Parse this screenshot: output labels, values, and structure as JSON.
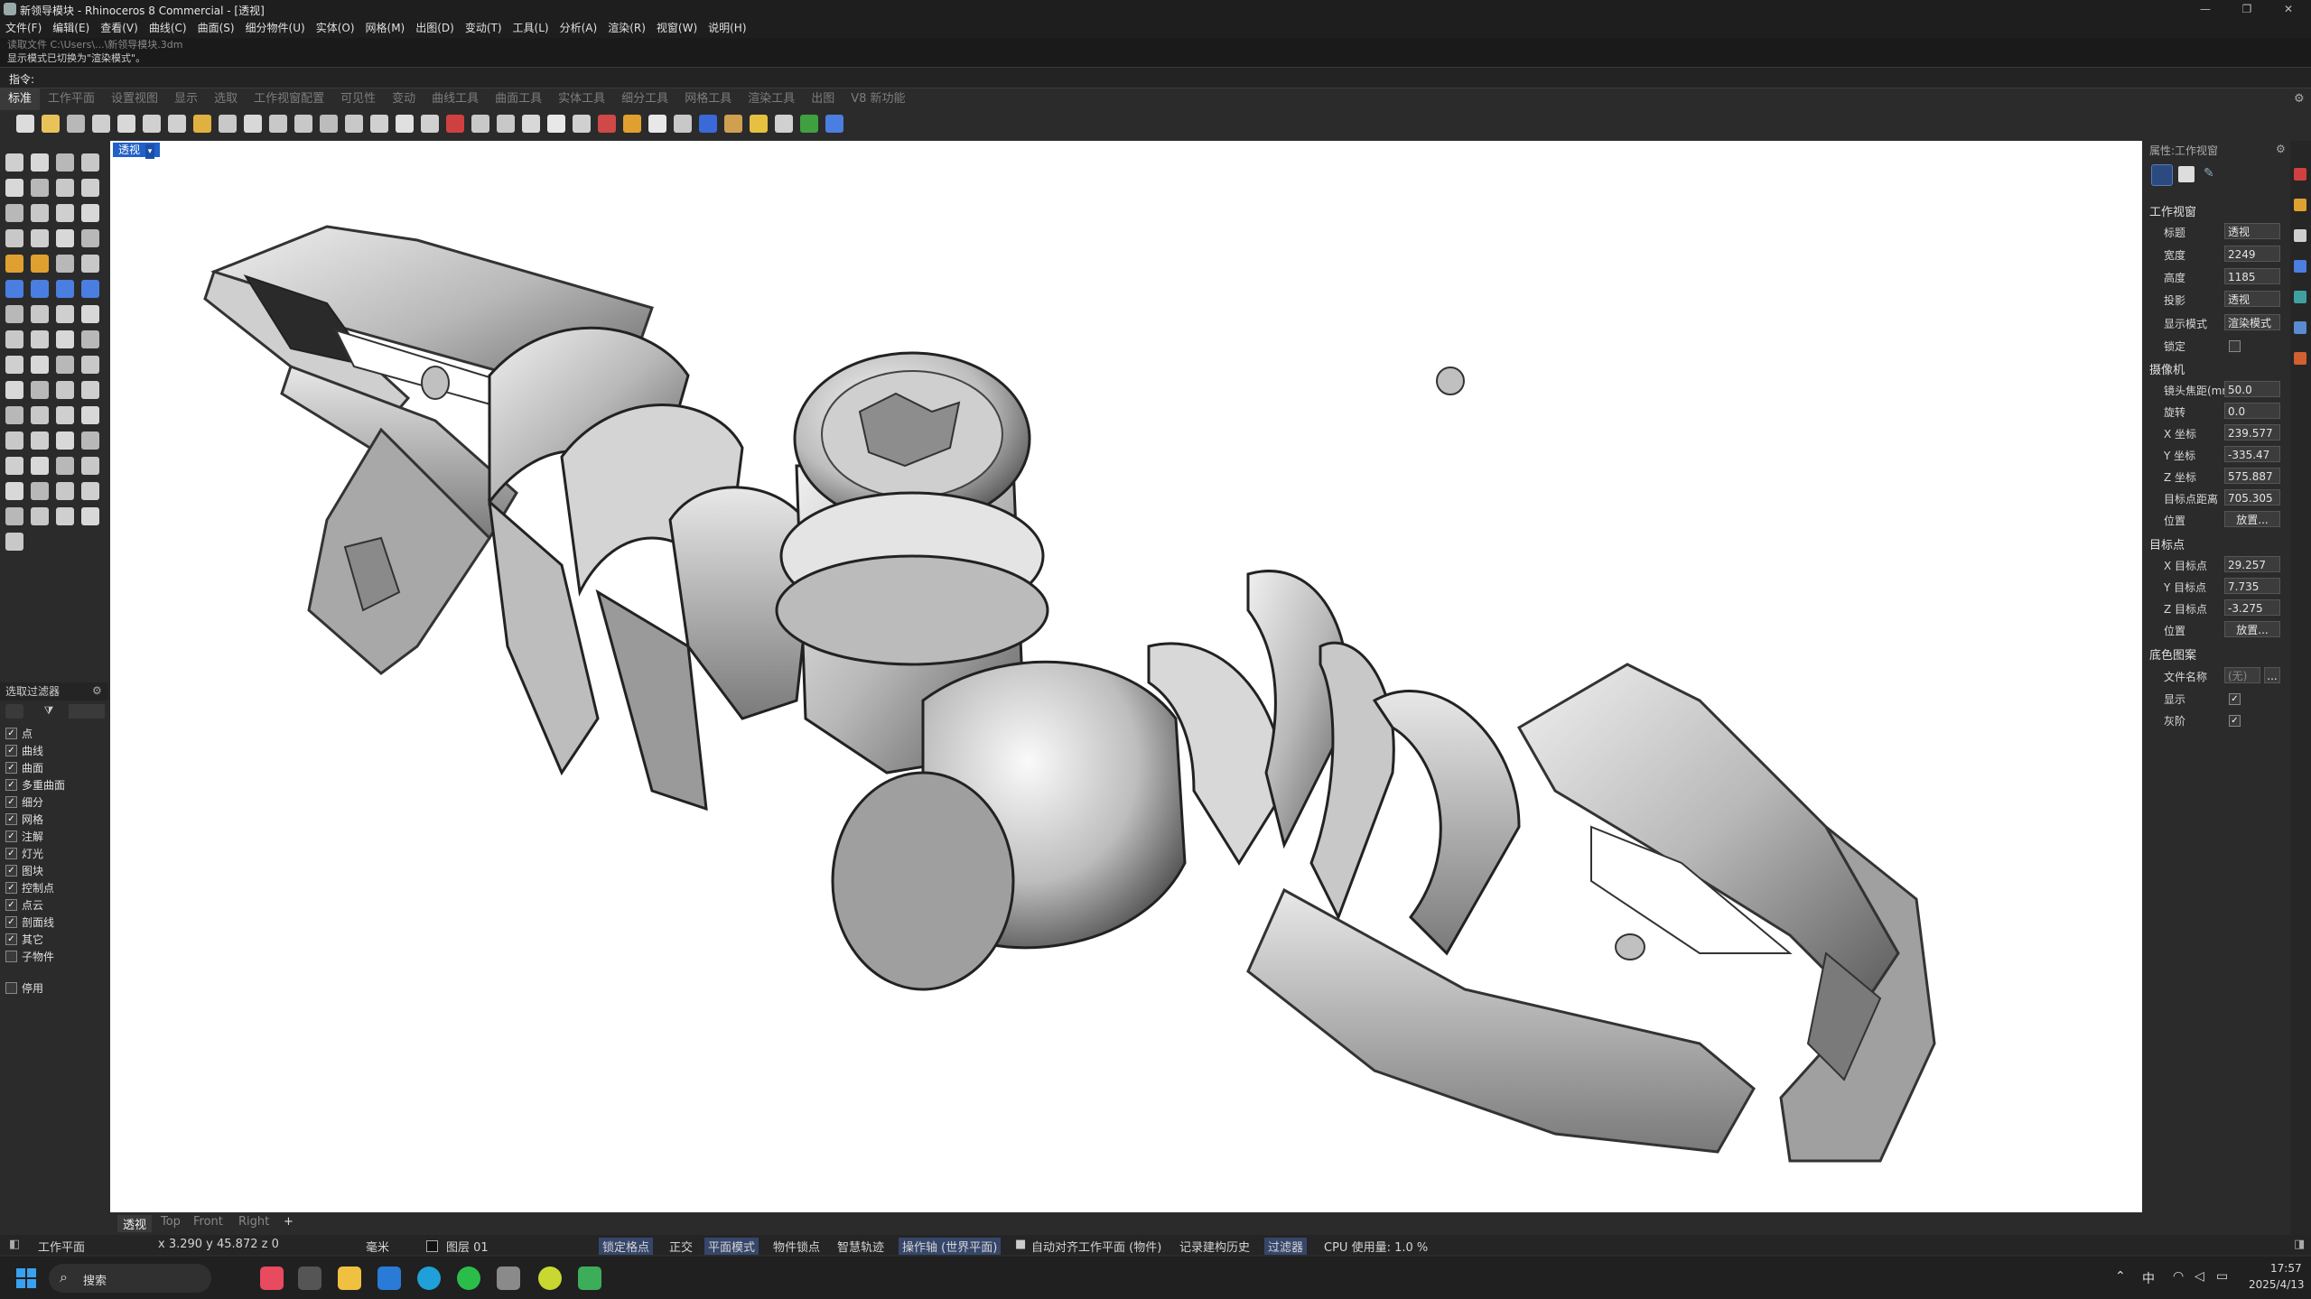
{
  "window": {
    "title": "新领导模块 - Rhinoceros 8 Commercial - [透视]",
    "min": "—",
    "max": "❐",
    "close": "✕"
  },
  "menu": [
    "文件(F)",
    "编辑(E)",
    "查看(V)",
    "曲线(C)",
    "曲面(S)",
    "细分物件(U)",
    "实体(O)",
    "网格(M)",
    "出图(D)",
    "变动(T)",
    "工具(L)",
    "分析(A)",
    "渲染(R)",
    "视窗(W)",
    "说明(H)"
  ],
  "command_history": {
    "line1": "读取文件 C:\\Users\\...\\新领导模块.3dm",
    "line2": "显示模式已切换为\"渲染模式\"。"
  },
  "command_prompt": "指令:",
  "toolbar_tabs": [
    {
      "label": "标准",
      "active": true
    },
    {
      "label": "工作平面"
    },
    {
      "label": "设置视图"
    },
    {
      "label": "显示"
    },
    {
      "label": "选取"
    },
    {
      "label": "工作视窗配置"
    },
    {
      "label": "可见性"
    },
    {
      "label": "变动"
    },
    {
      "label": "曲线工具"
    },
    {
      "label": "曲面工具"
    },
    {
      "label": "实体工具"
    },
    {
      "label": "细分工具"
    },
    {
      "label": "网格工具"
    },
    {
      "label": "渲染工具"
    },
    {
      "label": "出图"
    },
    {
      "label": "V8 新功能"
    }
  ],
  "toolbar_icon_colors": [
    "#dcdcdc",
    "#e8c35a",
    "#b8b8b8",
    "#cfcfcf",
    "#d8d8d8",
    "#d0d0d0",
    "#d0d0d0",
    "#e0b040",
    "#c8c8c8",
    "#d8d8d8",
    "#c8c8c8",
    "#c8c8c8",
    "#bcbcbc",
    "#c8c8c8",
    "#d0d0d0",
    "#e0e0e0",
    "#d0d0d0",
    "#d04040",
    "#c8c8c8",
    "#c8c8c8",
    "#d8d8d8",
    "#e8e8e8",
    "#d0d0d0",
    "#d04848",
    "#e0a030",
    "#e8e8e8",
    "#c8c8c8",
    "#3a6ad8",
    "#d0a050",
    "#e6c040",
    "#d0d0d0",
    "#40a040",
    "#4a7ee0"
  ],
  "viewport": {
    "title": "透视",
    "dropdown": "▾"
  },
  "select_filter": {
    "title": "选取过滤器",
    "items": [
      {
        "label": "点",
        "checked": true
      },
      {
        "label": "曲线",
        "checked": true
      },
      {
        "label": "曲面",
        "checked": true
      },
      {
        "label": "多重曲面",
        "checked": true
      },
      {
        "label": "细分",
        "checked": true
      },
      {
        "label": "网格",
        "checked": true
      },
      {
        "label": "注解",
        "checked": true
      },
      {
        "label": "灯光",
        "checked": true
      },
      {
        "label": "图块",
        "checked": true
      },
      {
        "label": "控制点",
        "checked": true
      },
      {
        "label": "点云",
        "checked": true
      },
      {
        "label": "剖面线",
        "checked": true
      },
      {
        "label": "其它",
        "checked": true
      },
      {
        "label": "子物件",
        "checked": false
      }
    ],
    "disable": {
      "label": "停用",
      "checked": false
    }
  },
  "properties": {
    "header": "属性:工作视窗",
    "viewport_section": "工作视窗",
    "title_label": "标题",
    "title_value": "透视",
    "width_label": "宽度",
    "width_value": "2249",
    "height_label": "高度",
    "height_value": "1185",
    "projection_label": "投影",
    "projection_value": "透视",
    "display_label": "显示模式",
    "display_value": "渲染模式",
    "lock_label": "锁定",
    "camera_section": "摄像机",
    "lens_label": "镜头焦距(mm)",
    "lens_value": "50.0",
    "rotation_label": "旋转",
    "rotation_value": "0.0",
    "x_label": "X 坐标",
    "x_value": "239.577",
    "y_label": "Y 坐标",
    "y_value": "-335.47",
    "z_label": "Z 坐标",
    "z_value": "575.887",
    "dist_label": "目标点距离",
    "dist_value": "705.305",
    "pos_label": "位置",
    "pos_button": "放置...",
    "target_section": "目标点",
    "tx_label": "X 目标点",
    "tx_value": "29.257",
    "ty_label": "Y 目标点",
    "ty_value": "7.735",
    "tz_label": "Z 目标点",
    "tz_value": "-3.275",
    "tpos_label": "位置",
    "tpos_button": "放置...",
    "wallpaper_section": "底色图案",
    "file_label": "文件名称",
    "file_value": "(无)",
    "file_browse": "...",
    "show_label": "显示",
    "show_checked": true,
    "gray_label": "灰阶",
    "gray_checked": true
  },
  "view_tabs": [
    "透视",
    "Top",
    "Front",
    "Right",
    "+"
  ],
  "status": {
    "cplane": "工作平面",
    "coords": "x 3.290   y 45.872   z 0",
    "units": "毫米",
    "layer": "图层 01",
    "grid_snap": "锁定格点",
    "ortho": "正交",
    "planar": "平面模式",
    "osnap": "物件锁点",
    "smarttrack": "智慧轨迹",
    "gumball": "操作轴 (世界平面)",
    "autoalign": "自动对齐工作平面 (物件)",
    "history": "记录建构历史",
    "filter": "过滤器",
    "cpu": "CPU 使用量: 1.0 %"
  },
  "taskbar": {
    "search": "搜索",
    "time": "17:57",
    "date": "2025/4/13",
    "ime": "中"
  }
}
